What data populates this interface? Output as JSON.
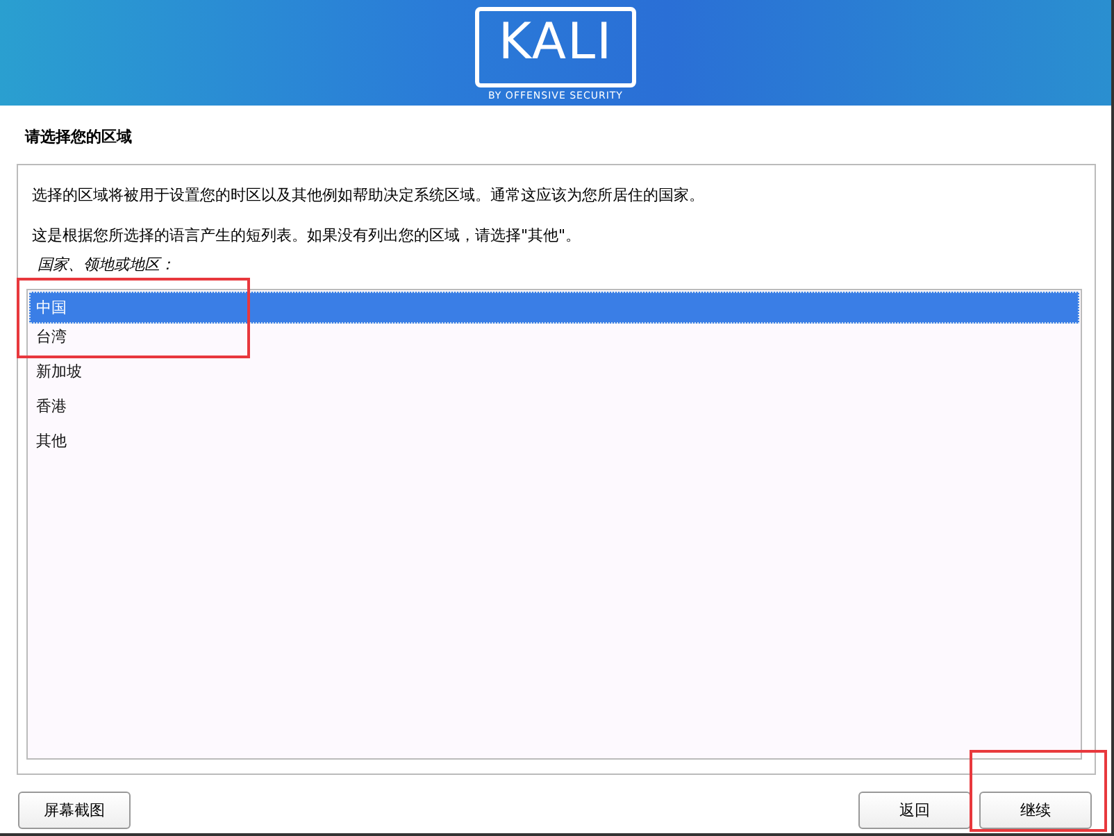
{
  "header": {
    "logo_text": "KALI",
    "logo_subtitle": "BY OFFENSIVE SECURITY"
  },
  "page_title": "请选择您的区域",
  "description": [
    "选择的区域将被用于设置您的时区以及其他例如帮助决定系统区域。通常这应该为您所居住的国家。",
    "这是根据您所选择的语言产生的短列表。如果没有列出您的区域，请选择\"其他\"。"
  ],
  "list_label": "国家、领地或地区：",
  "regions": [
    {
      "label": "中国",
      "selected": true
    },
    {
      "label": "台湾",
      "selected": false
    },
    {
      "label": "新加坡",
      "selected": false
    },
    {
      "label": "香港",
      "selected": false
    },
    {
      "label": "其他",
      "selected": false
    }
  ],
  "buttons": {
    "screenshot": "屏幕截图",
    "back": "返回",
    "continue": "继续"
  },
  "annotations": [
    {
      "kind": "rectangle",
      "color": "#e8383d"
    },
    {
      "kind": "rectangle",
      "color": "#e8383d"
    }
  ]
}
